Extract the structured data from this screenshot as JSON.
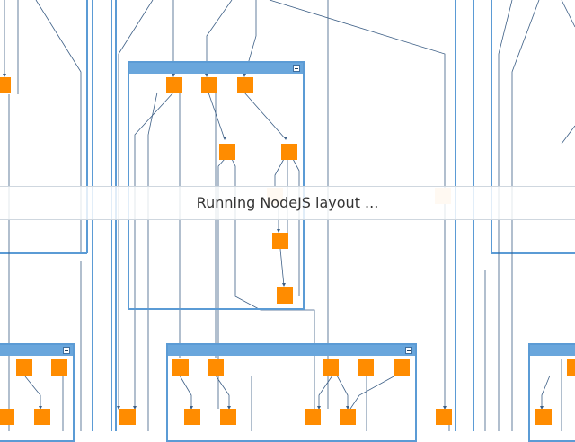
{
  "status": {
    "message": "Running NodeJS layout ..."
  },
  "icons": {
    "collapse": "minus-icon"
  },
  "colors": {
    "node": "#ff8c00",
    "node_faded": "#ffdcb8",
    "group_border": "#5b9bd5",
    "group_header": "#69a6dc",
    "edge": "#3d5f86"
  }
}
